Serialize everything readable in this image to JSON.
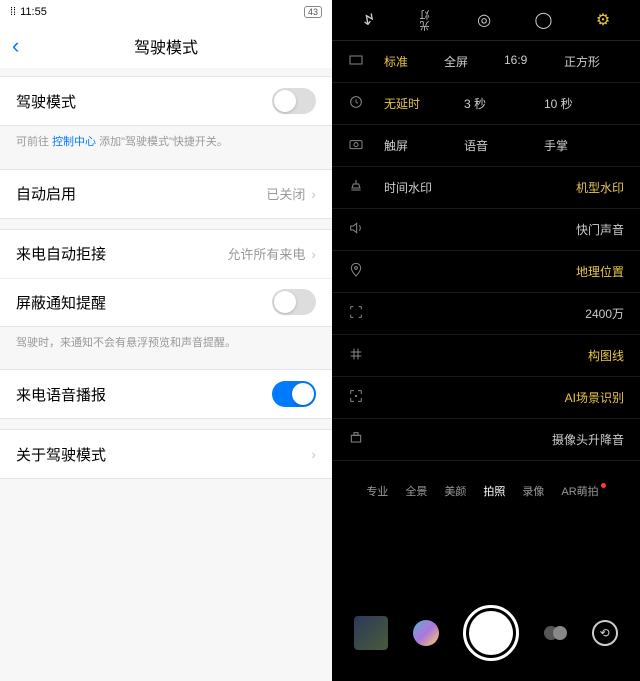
{
  "left": {
    "status": {
      "time": "11:55",
      "battery": "43"
    },
    "title": "驾驶模式",
    "driving_mode": "驾驶模式",
    "hint_pre": "可前往 ",
    "hint_link": "控制中心",
    "hint_post": " 添加\"驾驶模式\"快捷开关。",
    "auto_enable": "自动启用",
    "auto_enable_val": "已关闭",
    "auto_reject": "来电自动拒接",
    "auto_reject_val": "允许所有来电",
    "block_notif": "屏蔽通知提醒",
    "block_hint": "驾驶时，来通知不会有悬浮预览和声音提醒。",
    "voice_announce": "来电语音播报",
    "about": "关于驾驶模式"
  },
  "right": {
    "top_flash_text": "光灯",
    "ratio": {
      "opts": [
        "标准",
        "全屏",
        "16:9",
        "正方形"
      ],
      "sel": 0
    },
    "timer": {
      "opts": [
        "无延时",
        "3 秒",
        "10 秒"
      ],
      "sel": 0
    },
    "shutter_mode": {
      "opts": [
        "触屏",
        "语音",
        "手掌"
      ]
    },
    "watermark": {
      "label": "时间水印",
      "val": "机型水印"
    },
    "sound": "快门声音",
    "location": "地理位置",
    "resolution": "2400万",
    "grid": "构图线",
    "ai": "AI场景识别",
    "motor": "摄像头升降音",
    "modes": [
      "专业",
      "全景",
      "美颜",
      "拍照",
      "录像",
      "AR萌拍"
    ],
    "mode_sel": 3
  }
}
